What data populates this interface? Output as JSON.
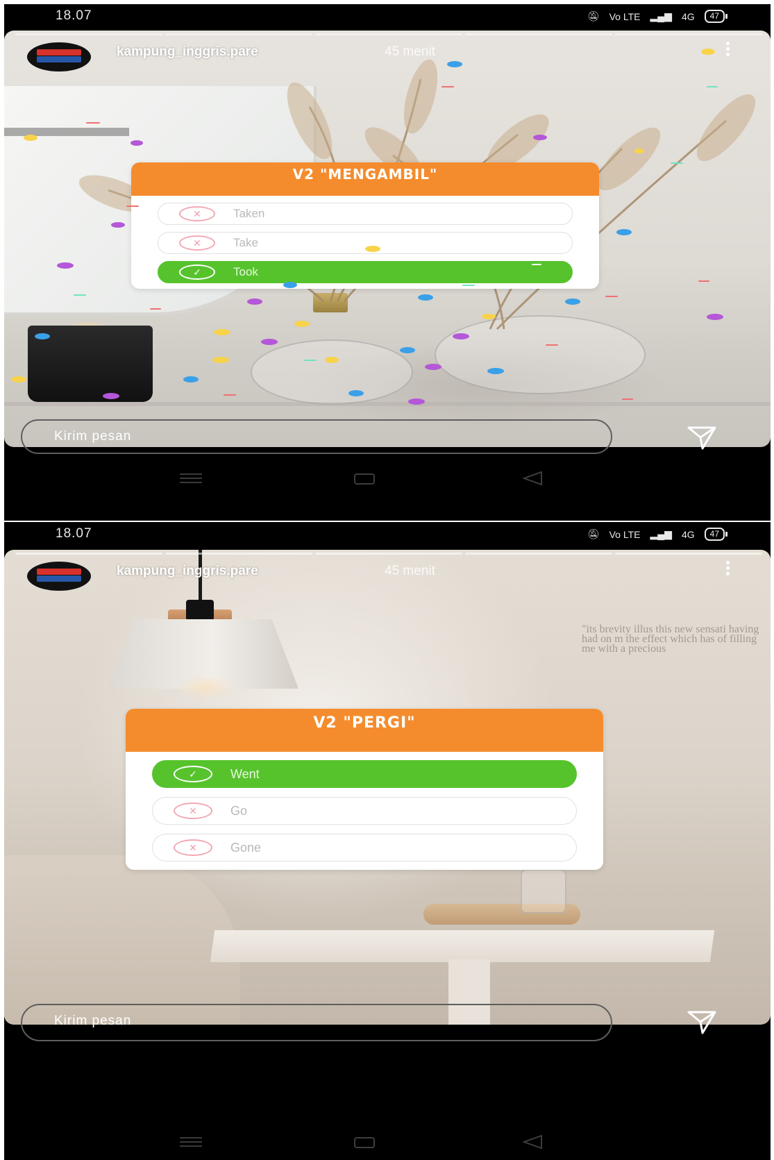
{
  "status_bar": {
    "time": "18.07",
    "battery": "47",
    "volte": "Vo LTE",
    "network": "4G"
  },
  "stories": [
    {
      "account": "kampung_inggris.pare",
      "time_ago": "45 menit",
      "quiz": {
        "title": "V2 \"MENGAMBIL\"",
        "options": [
          {
            "label": "Taken",
            "state": "wrong"
          },
          {
            "label": "Take",
            "state": "wrong"
          },
          {
            "label": "Took",
            "state": "correct"
          }
        ]
      }
    },
    {
      "account": "kampung_inggris.pare",
      "time_ago": "45 menit",
      "quiz": {
        "title": "V2 \"PERGI\"",
        "options": [
          {
            "label": "Went",
            "state": "correct"
          },
          {
            "label": "Go",
            "state": "wrong"
          },
          {
            "label": "Gone",
            "state": "wrong"
          }
        ]
      },
      "wall_text": "\"its brevity illus this new sensati having had on m the effect which has of filling me with a precious"
    }
  ],
  "reply": {
    "placeholder": "Kirim pesan"
  },
  "icons": {
    "wrong": "x-circle-icon",
    "correct": "check-circle-icon",
    "send": "paper-plane-icon",
    "menu": "vertical-dots-icon"
  },
  "colors": {
    "quiz_header": "#f48c2e",
    "correct": "#56c32c",
    "wrong_icon": "#f2a0ad"
  }
}
